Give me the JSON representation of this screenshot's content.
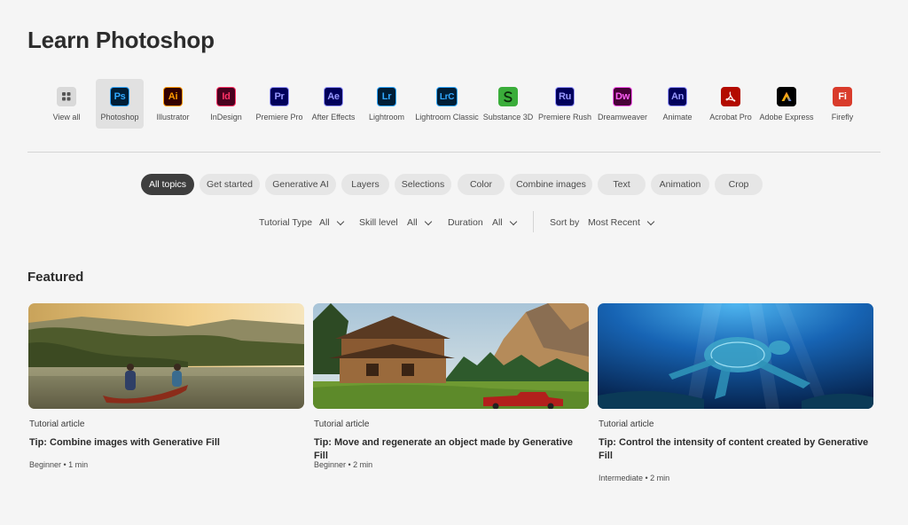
{
  "page_title": "Learn Photoshop",
  "apps": [
    {
      "label": "View all",
      "icon": "view-all-icon",
      "abbr": "",
      "bg": "#d9d9d9",
      "fg": "#4b4b4b"
    },
    {
      "label": "Photoshop",
      "icon": "photoshop-icon",
      "abbr": "Ps",
      "bg": "#001e36",
      "fg": "#31a8ff"
    },
    {
      "label": "Illustrator",
      "icon": "illustrator-icon",
      "abbr": "Ai",
      "bg": "#330000",
      "fg": "#ff9a00"
    },
    {
      "label": "InDesign",
      "icon": "indesign-icon",
      "abbr": "Id",
      "bg": "#49021f",
      "fg": "#ff3366"
    },
    {
      "label": "Premiere Pro",
      "icon": "premiere-pro-icon",
      "abbr": "Pr",
      "bg": "#00005b",
      "fg": "#9999ff"
    },
    {
      "label": "After Effects",
      "icon": "after-effects-icon",
      "abbr": "Ae",
      "bg": "#00005b",
      "fg": "#9999ff"
    },
    {
      "label": "Lightroom",
      "icon": "lightroom-icon",
      "abbr": "Lr",
      "bg": "#001e36",
      "fg": "#31a8ff"
    },
    {
      "label": "Lightroom Classic",
      "icon": "lightroom-classic-icon",
      "abbr": "LrC",
      "bg": "#001e36",
      "fg": "#31a8ff"
    },
    {
      "label": "Substance 3D",
      "icon": "substance-3d-icon",
      "abbr": "S",
      "bg": "#3aad3a",
      "fg": "#0b2b0b"
    },
    {
      "label": "Premiere Rush",
      "icon": "premiere-rush-icon",
      "abbr": "Ru",
      "bg": "#00005b",
      "fg": "#9999ff"
    },
    {
      "label": "Dreamweaver",
      "icon": "dreamweaver-icon",
      "abbr": "Dw",
      "bg": "#470137",
      "fg": "#ff61f6"
    },
    {
      "label": "Animate",
      "icon": "animate-icon",
      "abbr": "An",
      "bg": "#00005b",
      "fg": "#9999ff"
    },
    {
      "label": "Acrobat Pro",
      "icon": "acrobat-pro-icon",
      "abbr": "",
      "bg": "#b30b00",
      "fg": "#ffffff"
    },
    {
      "label": "Adobe Express",
      "icon": "adobe-express-icon",
      "abbr": "",
      "bg": "#000000",
      "fg": "#ff4f8b"
    },
    {
      "label": "Firefly",
      "icon": "firefly-icon",
      "abbr": "Fi",
      "bg": "#d93b2b",
      "fg": "#ffffff"
    }
  ],
  "selected_app": "Photoshop",
  "topics": [
    "All topics",
    "Get started",
    "Generative AI",
    "Layers",
    "Selections",
    "Color",
    "Combine images",
    "Text",
    "Animation",
    "Crop"
  ],
  "filters": {
    "tutorial_type_label": "Tutorial Type",
    "tutorial_type_value": "All",
    "skill_level_label": "Skill level",
    "skill_level_value": "All",
    "duration_label": "Duration",
    "duration_value": "All",
    "sort_label": "Sort by",
    "sort_value": "Most Recent"
  },
  "featured": {
    "title": "Featured",
    "cards": [
      {
        "type": "Tutorial article",
        "title": "Tip: Combine images with Generative Fill",
        "meta": "Beginner • 1 min",
        "image": "canoe-on-lake-image"
      },
      {
        "type": "Tutorial article",
        "title": "Tip: Move and regenerate an object made by Generative Fill",
        "meta": "Beginner • 2 min",
        "image": "cabin-with-red-truck-image"
      },
      {
        "type": "Tutorial article",
        "title": "Tip: Control the intensity of content created by Generative Fill",
        "meta": "Intermediate • 2 min",
        "image": "underwater-sea-turtle-image"
      }
    ]
  }
}
